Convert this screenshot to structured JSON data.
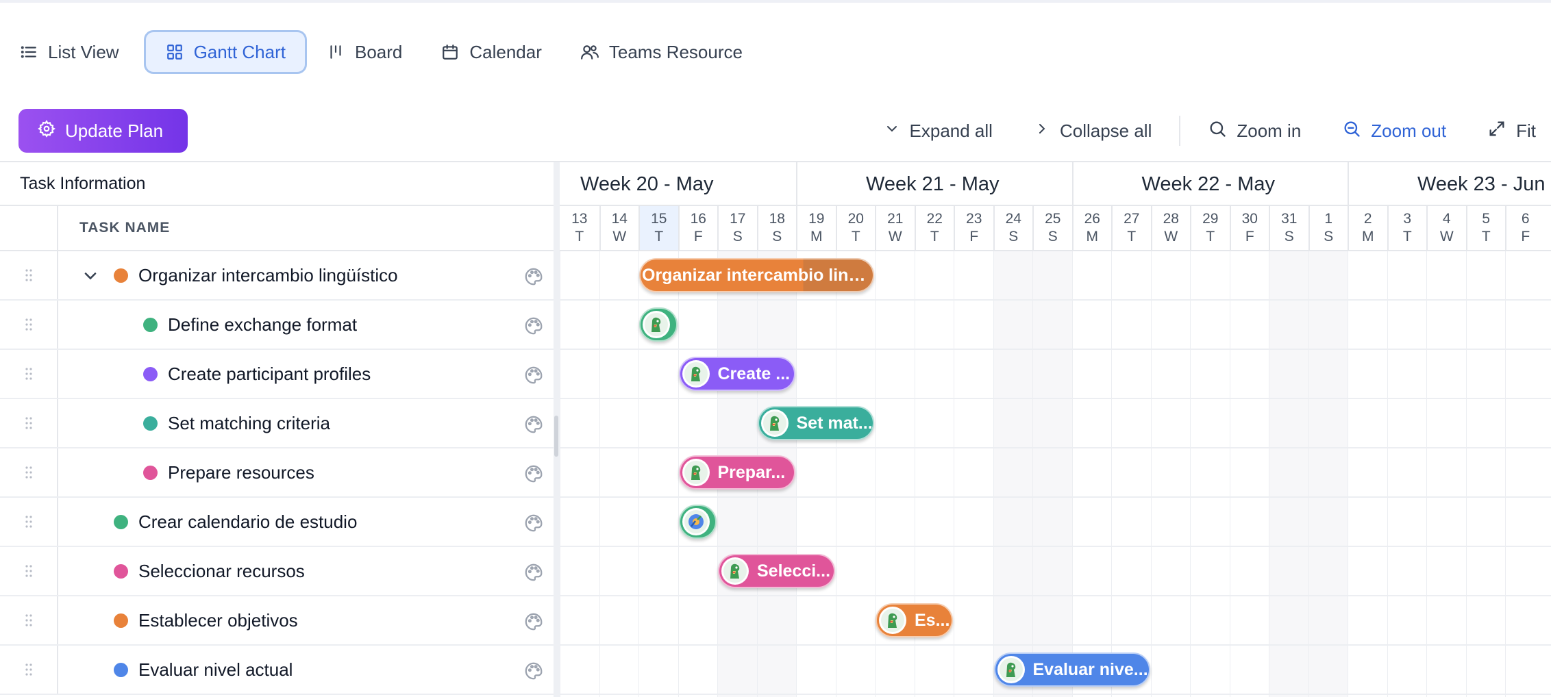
{
  "tabs": [
    {
      "label": "List View",
      "icon": "list-icon"
    },
    {
      "label": "Gantt Chart",
      "icon": "grid-icon",
      "active": true
    },
    {
      "label": "Board",
      "icon": "board-icon"
    },
    {
      "label": "Calendar",
      "icon": "calendar-icon"
    },
    {
      "label": "Teams Resource",
      "icon": "users-icon"
    }
  ],
  "toolbar": {
    "update_plan": "Update Plan",
    "expand_all": "Expand all",
    "collapse_all": "Collapse all",
    "zoom_in": "Zoom in",
    "zoom_out": "Zoom out",
    "fit": "Fit"
  },
  "grid_header": {
    "task_information": "Task Information",
    "task_name": "TASK NAME"
  },
  "weeks": [
    {
      "label": "Week 20 - May"
    },
    {
      "label": "Week 21 - May"
    },
    {
      "label": "Week 22 - May"
    },
    {
      "label": "Week 23 - Jun"
    }
  ],
  "days": [
    {
      "num": "13",
      "dow": "T"
    },
    {
      "num": "14",
      "dow": "W"
    },
    {
      "num": "15",
      "dow": "T",
      "today": true
    },
    {
      "num": "16",
      "dow": "F"
    },
    {
      "num": "17",
      "dow": "S",
      "weekend": true
    },
    {
      "num": "18",
      "dow": "S",
      "weekend": true
    },
    {
      "num": "19",
      "dow": "M"
    },
    {
      "num": "20",
      "dow": "T"
    },
    {
      "num": "21",
      "dow": "W"
    },
    {
      "num": "22",
      "dow": "T"
    },
    {
      "num": "23",
      "dow": "F"
    },
    {
      "num": "24",
      "dow": "S",
      "weekend": true
    },
    {
      "num": "25",
      "dow": "S",
      "weekend": true
    },
    {
      "num": "26",
      "dow": "M"
    },
    {
      "num": "27",
      "dow": "T"
    },
    {
      "num": "28",
      "dow": "W"
    },
    {
      "num": "29",
      "dow": "T"
    },
    {
      "num": "30",
      "dow": "F"
    },
    {
      "num": "31",
      "dow": "S",
      "weekend": true
    },
    {
      "num": "1",
      "dow": "S",
      "weekend": true
    },
    {
      "num": "2",
      "dow": "M"
    },
    {
      "num": "3",
      "dow": "T"
    },
    {
      "num": "4",
      "dow": "W"
    },
    {
      "num": "5",
      "dow": "T"
    },
    {
      "num": "6",
      "dow": "F"
    }
  ],
  "tasks": [
    {
      "name": "Organizar intercambio lingüístico",
      "color": "#e8823a",
      "level": 0,
      "expandable": true,
      "bar_label": "Organizar intercambio ling...",
      "start": "2024-05-15",
      "end": "2024-05-20",
      "parent": true
    },
    {
      "name": "Define exchange format",
      "color": "#3fb27f",
      "level": 1,
      "bar_label": "",
      "start": "2024-05-15",
      "end": "2024-05-15"
    },
    {
      "name": "Create participant profiles",
      "color": "#8b5cf6",
      "level": 1,
      "bar_label": "Create ...",
      "start": "2024-05-16",
      "end": "2024-05-18"
    },
    {
      "name": "Set matching criteria",
      "color": "#3aae9c",
      "level": 1,
      "bar_label": "Set mat...",
      "start": "2024-05-18",
      "end": "2024-05-20"
    },
    {
      "name": "Prepare resources",
      "color": "#e0559a",
      "level": 1,
      "bar_label": "Prepar...",
      "start": "2024-05-16",
      "end": "2024-05-18"
    },
    {
      "name": "Crear calendario de estudio",
      "color": "#3fb27f",
      "level": 0,
      "bar_label": "",
      "start": "2024-05-16",
      "end": "2024-05-16",
      "alt_avatar": true
    },
    {
      "name": "Seleccionar recursos",
      "color": "#e0559a",
      "level": 0,
      "bar_label": "Selecci...",
      "start": "2024-05-17",
      "end": "2024-05-19"
    },
    {
      "name": "Establecer objetivos",
      "color": "#e8823a",
      "level": 0,
      "bar_label": "Es...",
      "start": "2024-05-21",
      "end": "2024-05-22"
    },
    {
      "name": "Evaluar nivel actual",
      "color": "#4f86e8",
      "level": 0,
      "bar_label": "Evaluar nive...",
      "start": "2024-05-24",
      "end": "2024-05-27"
    }
  ]
}
